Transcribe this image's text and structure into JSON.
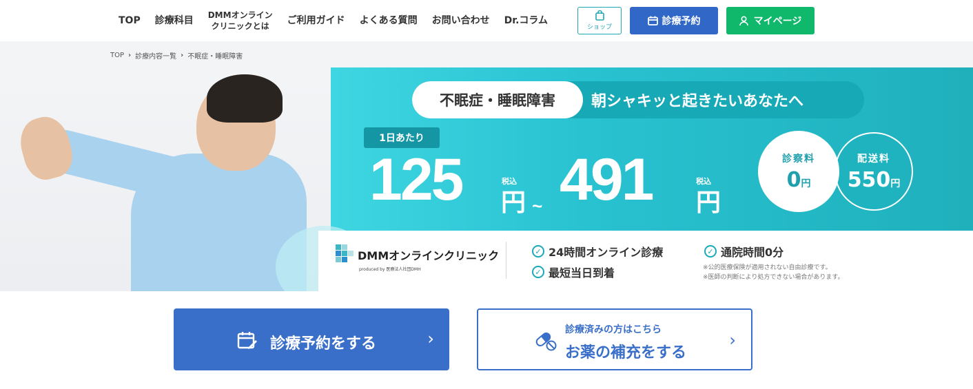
{
  "nav": {
    "items": [
      "TOP",
      "診療科目",
      "DMMオンライン\nクリニックとは",
      "ご利用ガイド",
      "よくある質問",
      "お問い合わせ",
      "Dr.コラム"
    ],
    "item_top": "TOP",
    "item_departments": "診療科目",
    "item_about_line1": "DMMオンライン",
    "item_about_line2": "クリニックとは",
    "item_guide": "ご利用ガイド",
    "item_faq": "よくある質問",
    "item_contact": "お問い合わせ",
    "item_column": "Dr.コラム"
  },
  "header": {
    "shop_label": "ショップ",
    "reserve_label": "診療予約",
    "mypage_label": "マイページ",
    "colors": {
      "shop": "#20a7b5",
      "reserve": "#3168c8",
      "mypage": "#10b86b"
    }
  },
  "breadcrumb": {
    "items": [
      "TOP",
      "診療内容一覧",
      "不眠症・睡眠障害"
    ],
    "item0": "TOP",
    "item1": "診療内容一覧",
    "item2": "不眠症・睡眠障害"
  },
  "hero": {
    "condition": "不眠症・睡眠障害",
    "catchphrase": "朝シャキッと起きたいあなたへ",
    "per_day_label": "1日あたり",
    "price_min": "125",
    "price_max": "491",
    "yen": "円",
    "tilde": "~",
    "tax_label": "税込",
    "consult_fee_label": "診察料",
    "consult_fee_value": "0",
    "shipping_fee_label": "配送料",
    "shipping_fee_value": "550",
    "logo_text": "DMMオンラインクリニック",
    "logo_sub": "produced by 医療法人社団DMH",
    "features": [
      "24時間オンライン診療",
      "最短当日到着",
      "通院時間0分"
    ],
    "feature1": "24時間オンライン診療",
    "feature2": "最短当日到着",
    "feature3": "通院時間0分",
    "note1": "※公的医療保険が適用されない自由診療です。",
    "note2": "※医師の判断により処方できない場合があります。",
    "colors": {
      "teal": "#29c2d1",
      "teal_dark": "#18a9b7"
    }
  },
  "cta": {
    "reserve_label": "診療予約をする",
    "refill_sub": "診療済みの方はこちら",
    "refill_label": "お薬の補充をする",
    "colors": {
      "primary": "#3a6fc9"
    }
  }
}
